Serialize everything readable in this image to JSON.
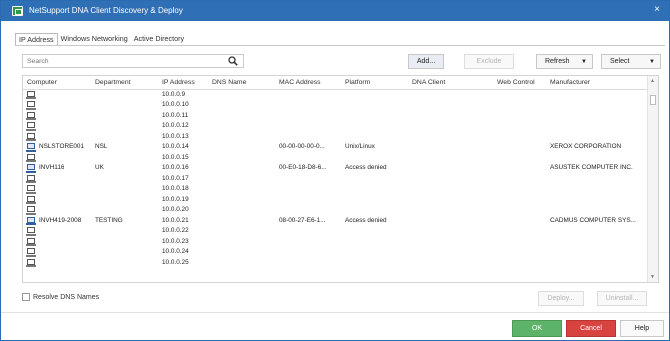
{
  "window": {
    "title": "NetSupport DNA Client Discovery & Deploy",
    "close_glyph": "×"
  },
  "tabs": [
    {
      "label": "IP Address"
    },
    {
      "label": "Windows Networking"
    },
    {
      "label": "Active Directory"
    }
  ],
  "search": {
    "placeholder": "Search",
    "value": ""
  },
  "toolbar": {
    "add": "Add...",
    "exclude": "Exclude",
    "refresh": "Refresh",
    "select": "Select"
  },
  "columns": [
    "Computer",
    "Department",
    "IP Address",
    "DNS Name",
    "MAC Address",
    "Platform",
    "DNA Client",
    "Web Control",
    "Manufacturer"
  ],
  "rows": [
    {
      "online": false,
      "computer": "",
      "department": "",
      "ip": "10.0.0.9",
      "dns": "",
      "mac": "",
      "platform": "",
      "dna": "",
      "web": "",
      "manufacturer": ""
    },
    {
      "online": false,
      "computer": "",
      "department": "",
      "ip": "10.0.0.10",
      "dns": "",
      "mac": "",
      "platform": "",
      "dna": "",
      "web": "",
      "manufacturer": ""
    },
    {
      "online": false,
      "computer": "",
      "department": "",
      "ip": "10.0.0.11",
      "dns": "",
      "mac": "",
      "platform": "",
      "dna": "",
      "web": "",
      "manufacturer": ""
    },
    {
      "online": false,
      "computer": "",
      "department": "",
      "ip": "10.0.0.12",
      "dns": "",
      "mac": "",
      "platform": "",
      "dna": "",
      "web": "",
      "manufacturer": ""
    },
    {
      "online": false,
      "computer": "",
      "department": "",
      "ip": "10.0.0.13",
      "dns": "",
      "mac": "",
      "platform": "",
      "dna": "",
      "web": "",
      "manufacturer": ""
    },
    {
      "online": true,
      "computer": "NSLSTORE001",
      "department": "NSL",
      "ip": "10.0.0.14",
      "dns": "",
      "mac": "00-00-00-00-0...",
      "platform": "Unix/Linux",
      "dna": "",
      "web": "",
      "manufacturer": "XEROX CORPORATION"
    },
    {
      "online": false,
      "computer": "",
      "department": "",
      "ip": "10.0.0.15",
      "dns": "",
      "mac": "",
      "platform": "",
      "dna": "",
      "web": "",
      "manufacturer": ""
    },
    {
      "online": true,
      "computer": "INVH116",
      "department": "UK",
      "ip": "10.0.0.16",
      "dns": "",
      "mac": "00-E0-18-D8-6...",
      "platform": "Access denied",
      "dna": "",
      "web": "",
      "manufacturer": "ASUSTEK COMPUTER INC."
    },
    {
      "online": false,
      "computer": "",
      "department": "",
      "ip": "10.0.0.17",
      "dns": "",
      "mac": "",
      "platform": "",
      "dna": "",
      "web": "",
      "manufacturer": ""
    },
    {
      "online": false,
      "computer": "",
      "department": "",
      "ip": "10.0.0.18",
      "dns": "",
      "mac": "",
      "platform": "",
      "dna": "",
      "web": "",
      "manufacturer": ""
    },
    {
      "online": false,
      "computer": "",
      "department": "",
      "ip": "10.0.0.19",
      "dns": "",
      "mac": "",
      "platform": "",
      "dna": "",
      "web": "",
      "manufacturer": ""
    },
    {
      "online": false,
      "computer": "",
      "department": "",
      "ip": "10.0.0.20",
      "dns": "",
      "mac": "",
      "platform": "",
      "dna": "",
      "web": "",
      "manufacturer": ""
    },
    {
      "online": true,
      "computer": "INVH419-2008",
      "department": "TESTING",
      "ip": "10.0.0.21",
      "dns": "",
      "mac": "08-00-27-E6-1...",
      "platform": "Access denied",
      "dna": "",
      "web": "",
      "manufacturer": "CADMUS COMPUTER SYS..."
    },
    {
      "online": false,
      "computer": "",
      "department": "",
      "ip": "10.0.0.22",
      "dns": "",
      "mac": "",
      "platform": "",
      "dna": "",
      "web": "",
      "manufacturer": ""
    },
    {
      "online": false,
      "computer": "",
      "department": "",
      "ip": "10.0.0.23",
      "dns": "",
      "mac": "",
      "platform": "",
      "dna": "",
      "web": "",
      "manufacturer": ""
    },
    {
      "online": false,
      "computer": "",
      "department": "",
      "ip": "10.0.0.24",
      "dns": "",
      "mac": "",
      "platform": "",
      "dna": "",
      "web": "",
      "manufacturer": ""
    },
    {
      "online": false,
      "computer": "",
      "department": "",
      "ip": "10.0.0.25",
      "dns": "",
      "mac": "",
      "platform": "",
      "dna": "",
      "web": "",
      "manufacturer": ""
    }
  ],
  "options": {
    "resolve_dns": "Resolve DNS Names",
    "resolve_dns_checked": false
  },
  "actions": {
    "deploy": "Deploy...",
    "uninstall": "Uninstall..."
  },
  "footer": {
    "ok": "OK",
    "cancel": "Cancel",
    "help": "Help"
  },
  "icons": {
    "app": "netsupport-dna-icon",
    "search": "search-icon",
    "computer": "computer-icon"
  },
  "colors": {
    "titlebar": "#2e6fb5",
    "ok": "#5db369",
    "cancel": "#d9433f"
  }
}
